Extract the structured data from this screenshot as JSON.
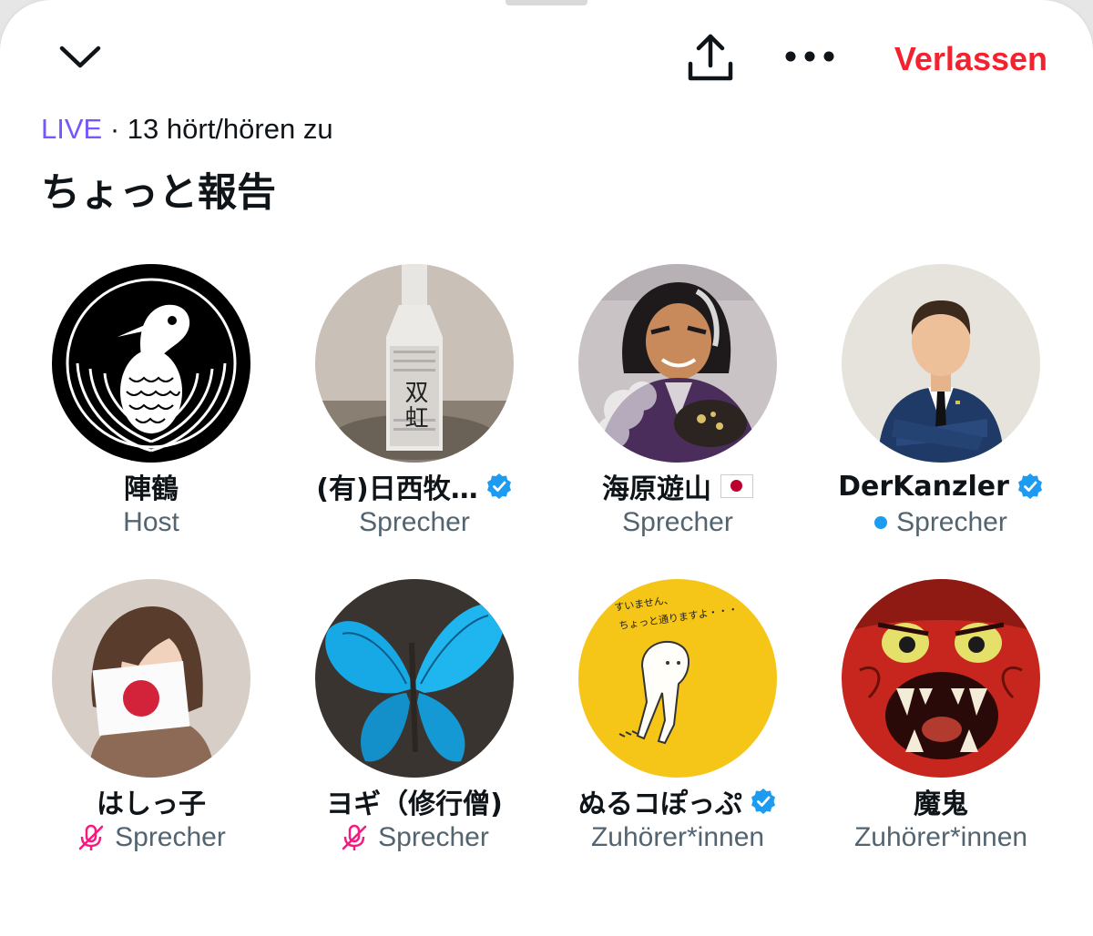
{
  "header": {
    "leave_label": "Verlassen",
    "collapse_icon": "chevron-down-icon",
    "share_icon": "share-icon",
    "more_icon": "more-horizontal-icon",
    "leave_color": "#f4212e"
  },
  "space": {
    "live_label": "LIVE",
    "separator": "·",
    "listeners": "13 hört/hören zu",
    "title": "ちょっと報告",
    "live_color": "#7856ff"
  },
  "members": [
    {
      "name": "陣鶴",
      "role": "Host",
      "verified": false,
      "flag": false,
      "status": "none"
    },
    {
      "name": "(有)日西牧…",
      "role": "Sprecher",
      "verified": true,
      "flag": false,
      "status": "none"
    },
    {
      "name": "海原遊山",
      "role": "Sprecher",
      "verified": false,
      "flag": true,
      "status": "none"
    },
    {
      "name": "DerKanzler",
      "role": "Sprecher",
      "verified": true,
      "flag": false,
      "status": "speaking"
    },
    {
      "name": "はしっ子",
      "role": "Sprecher",
      "verified": false,
      "flag": false,
      "status": "muted"
    },
    {
      "name": "ヨギ（修行僧)",
      "role": "Sprecher",
      "verified": false,
      "flag": false,
      "status": "muted"
    },
    {
      "name": "ぬるコぽっぷ",
      "role": "Zuhörer*innen",
      "verified": true,
      "flag": false,
      "status": "none"
    },
    {
      "name": "魔鬼",
      "role": "Zuhörer*innen",
      "verified": false,
      "flag": false,
      "status": "none"
    }
  ],
  "avatar_texts": {
    "sake_label": "双虹",
    "sign_line1": "すいません、",
    "sign_line2": "ちょっと通りますよ・・・"
  },
  "colors": {
    "verified": "#1d9bf0",
    "muted": "#f91880",
    "text": "#0f1419",
    "secondary": "#536471"
  }
}
